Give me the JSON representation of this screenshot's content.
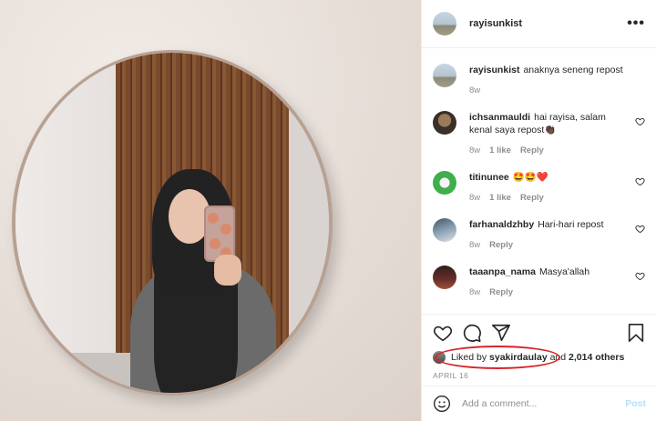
{
  "post": {
    "username": "rayisunkist",
    "more_label": "•••"
  },
  "comments": [
    {
      "user": "rayisunkist",
      "text": "anaknya seneng repost",
      "time": "8w",
      "likes": "",
      "reply": "",
      "avatar": "rayisunkist-avatar"
    },
    {
      "user": "ichsanmauldi",
      "text": "hai rayisa, salam kenal saya repost👏🏿",
      "time": "8w",
      "likes": "1 like",
      "reply": "Reply",
      "avatar": "ichsanmauldi-avatar"
    },
    {
      "user": "titinunee",
      "text": "🤩🤩❤️",
      "time": "8w",
      "likes": "1 like",
      "reply": "Reply",
      "avatar": "titinunee-avatar"
    },
    {
      "user": "farhanaldzhby",
      "text": "Hari-hari repost",
      "time": "8w",
      "likes": "",
      "reply": "Reply",
      "avatar": "farhanaldzhby-avatar"
    },
    {
      "user": "taaanpa_nama",
      "text": "Masya'allah",
      "time": "8w",
      "likes": "",
      "reply": "Reply",
      "avatar": "taaanpa_nama-avatar"
    }
  ],
  "likes": {
    "prefix": "Liked by ",
    "user": "syakirdaulay",
    "middle": " and ",
    "count": "2,014 others"
  },
  "date": "APRIL 16",
  "add_comment": {
    "placeholder": "Add a comment...",
    "post_label": "Post"
  },
  "colors": {
    "accent": "#0095f6",
    "post_disabled": "#b2dffc",
    "annotation_circle": "#d8262a"
  }
}
